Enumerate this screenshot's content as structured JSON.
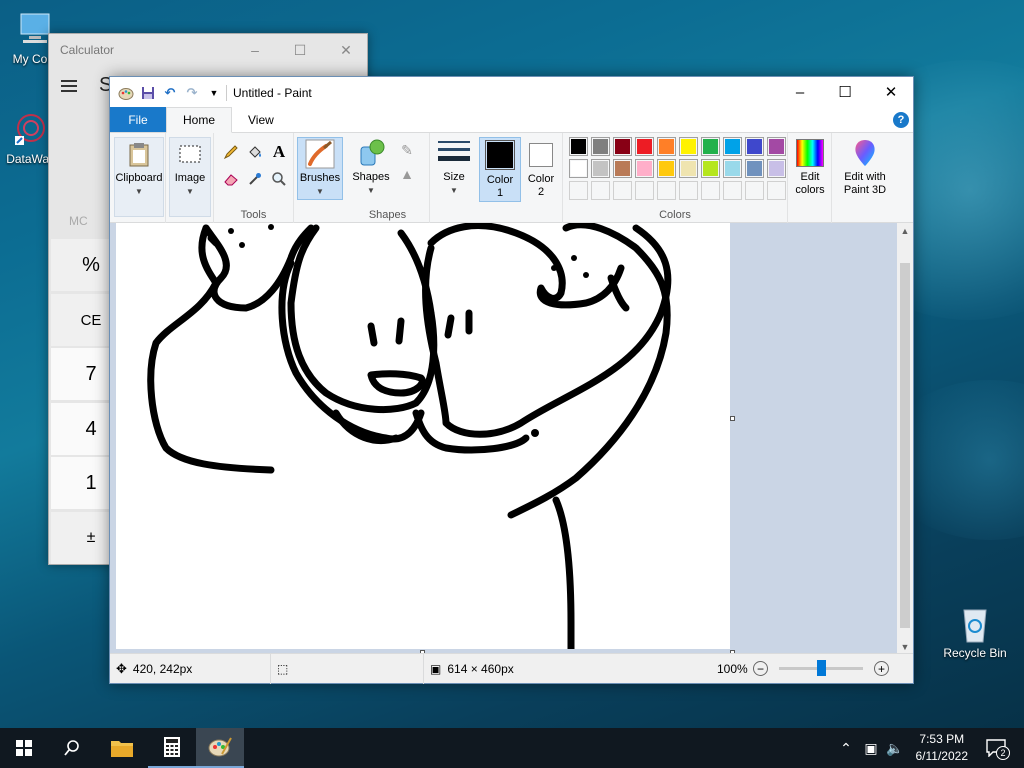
{
  "desktop": {
    "icons": [
      {
        "label": "My Com"
      },
      {
        "label": "DataWag"
      },
      {
        "label": "Recycle Bin"
      }
    ]
  },
  "calculator": {
    "title": "Calculator",
    "mode_initial": "S",
    "memory_label": "MC",
    "keys": [
      "%",
      "CE",
      "7",
      "4",
      "1",
      "±"
    ]
  },
  "paint": {
    "title": "Untitled - Paint",
    "tabs": [
      "File",
      "Home",
      "View"
    ],
    "help": "?",
    "groups": {
      "clipboard": "Clipboard",
      "image": "Image",
      "tools": "Tools",
      "brushes": "Brushes",
      "shapes_btn": "Shapes",
      "shapes": "Shapes",
      "size": "Size",
      "color1": "Color",
      "color1_num": "1",
      "color2": "Color",
      "color2_num": "2",
      "colors": "Colors",
      "edit_colors_1": "Edit",
      "edit_colors_2": "colors",
      "paint3d_1": "Edit with",
      "paint3d_2": "Paint 3D"
    },
    "palette_row1": [
      "#000000",
      "#7f7f7f",
      "#880015",
      "#ed1c24",
      "#ff7f27",
      "#fff200",
      "#22b14c",
      "#00a2e8",
      "#3f48cc",
      "#a349a4"
    ],
    "palette_row2": [
      "#ffffff",
      "#c3c3c3",
      "#b97a57",
      "#ffaec9",
      "#ffc90e",
      "#efe4b0",
      "#b5e61d",
      "#99d9ea",
      "#7092be",
      "#c8bfe7"
    ],
    "color1_value": "#000000",
    "color2_value": "#ffffff",
    "status": {
      "cursor_pos": "420, 242px",
      "canvas_size": "614 × 460px",
      "zoom": "100%"
    }
  },
  "taskbar": {
    "time": "7:53 PM",
    "date": "6/11/2022",
    "notifications": "2"
  }
}
